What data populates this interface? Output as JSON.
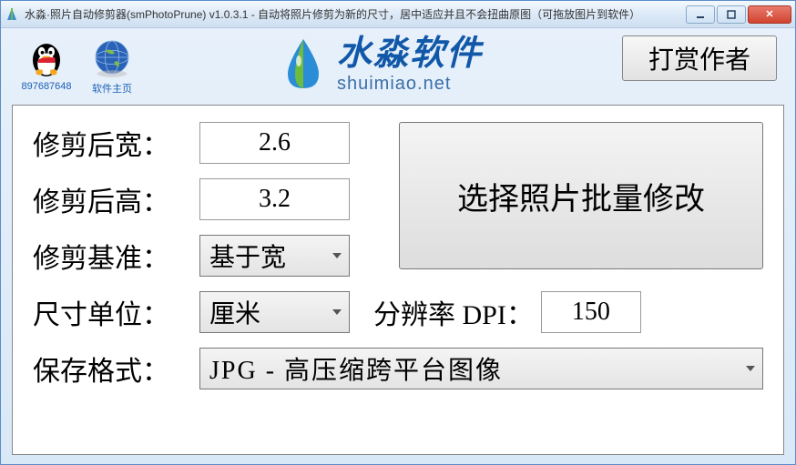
{
  "window": {
    "title": "水淼·照片自动修剪器(smPhotoPrune) v1.0.3.1 - 自动将照片修剪为新的尺寸，居中适应并且不会扭曲原图（可拖放图片到软件）"
  },
  "header": {
    "qq_number": "897687648",
    "homepage_label": "软件主页",
    "brand_cn": "水淼软件",
    "brand_url": "shuimiao.net",
    "donate_label": "打赏作者"
  },
  "form": {
    "width_label": "修剪后宽：",
    "width_value": "2.6",
    "height_label": "修剪后高：",
    "height_value": "3.2",
    "basis_label": "修剪基准：",
    "basis_value": "基于宽",
    "unit_label": "尺寸单位：",
    "unit_value": "厘米",
    "dpi_label": "分辨率 DPI：",
    "dpi_value": "150",
    "format_label": "保存格式：",
    "format_value": "JPG -  高压缩跨平台图像",
    "batch_button": "选择照片批量修改"
  }
}
